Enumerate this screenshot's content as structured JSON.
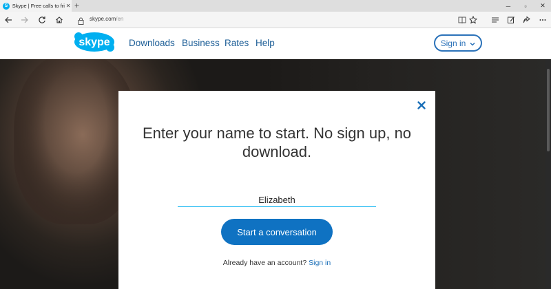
{
  "browser": {
    "tab_title": "Skype | Free calls to frie",
    "tab_icon": "skype-favicon",
    "new_tab_label": "+",
    "url_domain": "skype.com",
    "url_path": "/en",
    "window_controls": [
      "minimize",
      "maximize",
      "close"
    ],
    "toolbar_icons": [
      "reading-view-icon",
      "favorite-star-icon",
      "hub-icon",
      "web-note-icon",
      "share-icon",
      "more-icon"
    ]
  },
  "site": {
    "logo_text": "skype",
    "nav": [
      "Downloads",
      "Business",
      "Rates",
      "Help"
    ],
    "signin_label": "Sign in",
    "brand_color": "#00aff0",
    "link_color": "#1b5d96"
  },
  "modal": {
    "heading": "Enter your name to start. No sign up, no download.",
    "name_value": "Elizabeth",
    "start_button": "Start a conversation",
    "account_prompt": "Already have an account?",
    "account_link": "Sign in",
    "button_color": "#0f72c2"
  }
}
